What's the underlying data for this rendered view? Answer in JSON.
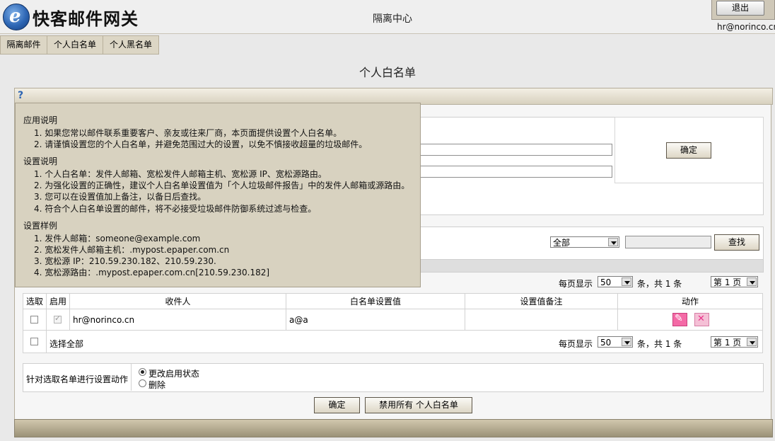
{
  "header": {
    "logo_text": "快客邮件网关",
    "title": "隔离中心",
    "logout_label": "退出",
    "user_email": "hr@norinco.cn"
  },
  "tabs": [
    {
      "label": "隔离邮件"
    },
    {
      "label": "个人白名单"
    },
    {
      "label": "个人黑名单"
    }
  ],
  "page": {
    "title": "个人白名单",
    "help_icon": "?"
  },
  "tooltip": {
    "app_heading": "应用说明",
    "app_items": [
      "1.  如果您常以邮件联系重要客户、亲友或往来厂商，本页面提供设置个人白名单。",
      "2.  请谨慎设置您的个人白名单，并避免范围过大的设置，以免不慎接收超量的垃圾邮件。"
    ],
    "settings_heading": "设置说明",
    "settings_items": [
      "1.  个人白名单：发件人邮箱、宽松发件人邮箱主机、宽松源 IP、宽松源路由。",
      "2.  为强化设置的正确性，建议个人白名单设置值为「个人垃圾邮件报告」中的发件人邮箱或源路由。",
      "3.  您可以在设置值加上备注，以备日后查找。",
      "4.  符合个人白名单设置的邮件，将不必接受垃圾邮件防御系统过滤与检查。"
    ],
    "examples_heading": "设置样例",
    "examples_items": [
      "1.  发件人邮箱：someone@example.com",
      "2.  宽松发件人邮箱主机：.mypost.epaper.com.cn",
      "3.  宽松源 IP：210.59.230.182、210.59.230.",
      "4.  宽松源路由：.mypost.epaper.com.cn[210.59.230.182]"
    ]
  },
  "add_form": {
    "confirm_label": "确定"
  },
  "search": {
    "filter_value": "全部",
    "search_label": "查找",
    "query": ""
  },
  "pager": {
    "per_page_label": "每页显示",
    "per_page_value": "50",
    "summary": "条，共 1 条",
    "page_value": "第 1 页"
  },
  "table": {
    "headers": [
      "选取",
      "启用",
      "收件人",
      "白名单设置值",
      "设置值备注",
      "动作"
    ],
    "rows": [
      {
        "recipient": "hr@norinco.cn",
        "value": "a@a",
        "note": ""
      }
    ],
    "select_all_label": "选择全部"
  },
  "bulk": {
    "label": "针对选取名单进行设置动作",
    "options": [
      {
        "label": "更改启用状态",
        "selected": true
      },
      {
        "label": "删除",
        "selected": false
      }
    ],
    "confirm_label": "确定",
    "disable_all_label": "禁用所有 个人白名单"
  }
}
